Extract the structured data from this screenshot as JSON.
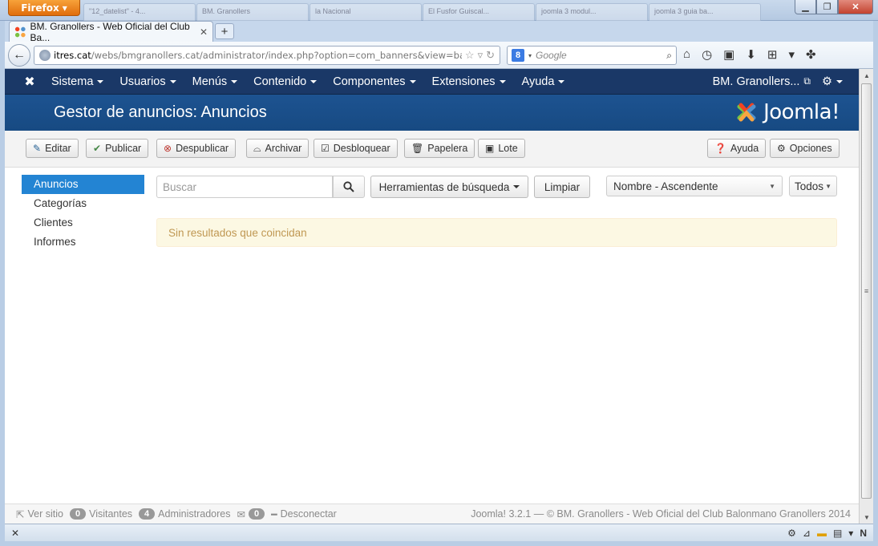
{
  "browser": {
    "menu_label": "Firefox",
    "background_tabs": [
      "\"12_datelist\" - 4...",
      "BM. Granollers",
      "la Nacional",
      "El Fusfor Guiscal...",
      "joomla 3 modul...",
      "joomla 3 guia ba..."
    ],
    "active_tab_title": "BM. Granollers - Web Oficial del Club Ba...",
    "url_domain": "itres.cat",
    "url_path": "/webs/bmgranollers.cat/administrator/index.php?option=com_banners&view=banne",
    "search_engine": "Google",
    "search_placeholder": "Google"
  },
  "topmenu": {
    "items": [
      "Sistema",
      "Usuarios",
      "Menús",
      "Contenido",
      "Componentes",
      "Extensiones",
      "Ayuda"
    ],
    "site_name": "BM. Granollers...",
    "brand": "Joomla!"
  },
  "header": {
    "title": "Gestor de anuncios: Anuncios"
  },
  "toolbar": {
    "edit": "Editar",
    "publish": "Publicar",
    "unpublish": "Despublicar",
    "archive": "Archivar",
    "checkin": "Desbloquear",
    "trash": "Papelera",
    "batch": "Lote",
    "help": "Ayuda",
    "options": "Opciones"
  },
  "sidebar": {
    "items": [
      {
        "label": "Anuncios",
        "active": true
      },
      {
        "label": "Categorías",
        "active": false
      },
      {
        "label": "Clientes",
        "active": false
      },
      {
        "label": "Informes",
        "active": false
      }
    ]
  },
  "filters": {
    "search_placeholder": "Buscar",
    "search_tools": "Herramientas de búsqueda",
    "clear": "Limpiar",
    "ordering": "Nombre - Ascendente",
    "limit": "Todos"
  },
  "message": "Sin resultados que coincidan",
  "footer": {
    "view_site": "Ver sitio",
    "visitors_count": "0",
    "visitors_label": "Visitantes",
    "admins_count": "4",
    "admins_label": "Administradores",
    "messages_count": "0",
    "logout": "Desconectar",
    "copyright": "Joomla! 3.2.1  —  © BM. Granollers - Web Oficial del Club Balonmano Granollers 2014"
  },
  "colors": {
    "topmenu_bg": "#1a3867",
    "header_bg": "#1d5391",
    "sidebar_active": "#2384d3",
    "alert_bg": "#fcf8e3",
    "alert_text": "#c09853"
  }
}
